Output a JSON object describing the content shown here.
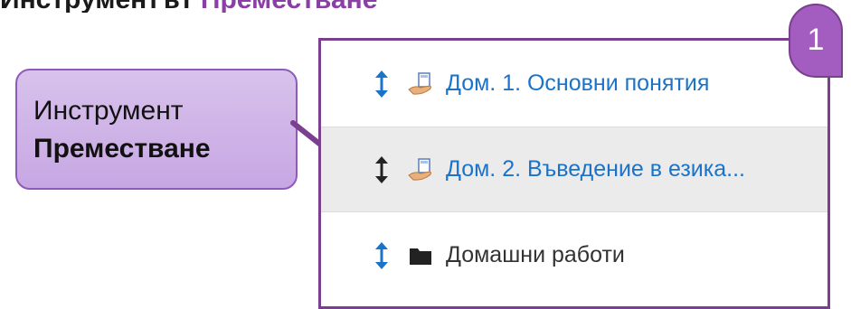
{
  "heading_fragment": {
    "text_start": "Инструментът",
    "text_accent": "Преместване"
  },
  "callout": {
    "line1": "Инструмент",
    "line2": "Преместване"
  },
  "badge": {
    "number": "1"
  },
  "list": {
    "items": [
      {
        "label": "Дом. 1. Основни понятия",
        "type": "link",
        "icon": "hand-document-icon"
      },
      {
        "label": "Дом. 2. Въведение в езика...",
        "type": "link",
        "icon": "hand-document-icon",
        "highlighted": true
      },
      {
        "label": "Домашни работи",
        "type": "folder",
        "icon": "folder-icon"
      }
    ]
  },
  "colors": {
    "accent": "#8a3fa6",
    "panel_border": "#7b3f8f",
    "badge": "#a35cbf",
    "link": "#1a73c9",
    "move_icon": "#1a73c9",
    "callout_fill": "#d0b3ea"
  }
}
